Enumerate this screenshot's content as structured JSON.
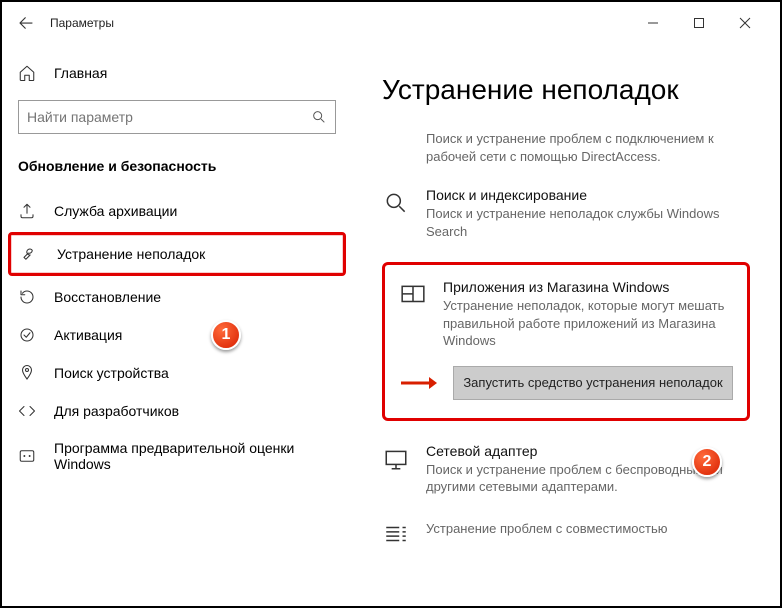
{
  "titlebar": {
    "app_title": "Параметры"
  },
  "sidebar": {
    "home_label": "Главная",
    "search_placeholder": "Найти параметр",
    "section_header": "Обновление и безопасность",
    "items": [
      {
        "label": "Служба архивации"
      },
      {
        "label": "Устранение неполадок"
      },
      {
        "label": "Восстановление"
      },
      {
        "label": "Активация"
      },
      {
        "label": "Поиск устройства"
      },
      {
        "label": "Для разработчиков"
      },
      {
        "label": "Программа предварительной оценки Windows"
      }
    ]
  },
  "main": {
    "page_title": "Устранение неполадок",
    "items": [
      {
        "title": "",
        "desc": "Поиск и устранение проблем с подключением к рабочей сети с помощью DirectAccess."
      },
      {
        "title": "Поиск и индексирование",
        "desc": "Поиск и устранение неполадок службы Windows Search"
      },
      {
        "title": "Приложения из Магазина Windows",
        "desc": "Устранение неполадок, которые могут мешать правильной работе приложений из Магазина Windows"
      },
      {
        "title": "Сетевой адаптер",
        "desc": "Поиск и устранение проблем с беспроводными и другими сетевыми адаптерами."
      },
      {
        "title": "",
        "desc": "Устранение проблем с совместимостью"
      }
    ],
    "run_button": "Запустить средство устранения неполадок"
  },
  "badges": {
    "one": "1",
    "two": "2"
  }
}
